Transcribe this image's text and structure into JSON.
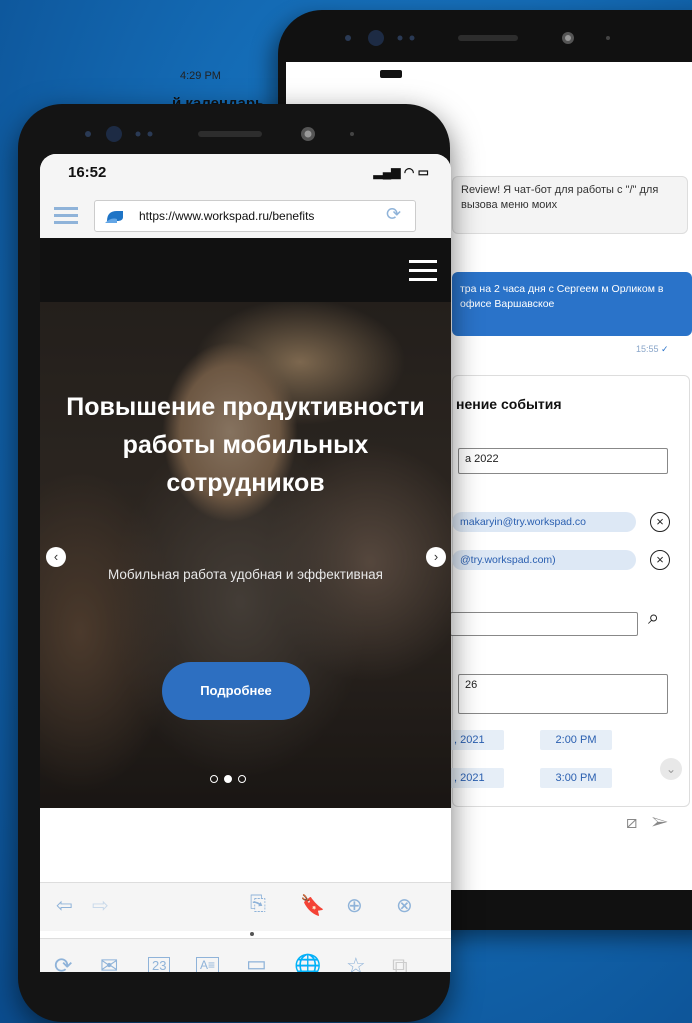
{
  "back_phone": {
    "status_time": "4:29 PM",
    "chat_title": "й календарь",
    "bot_message": "Review! Я чат-бот для работы с \"/\" для вызова меню моих",
    "user_message": "тра на 2 часа дня с Сергеем м Орликом в офисе Варшавское",
    "message_time": "15:55",
    "form_title": "нение события",
    "date_field": "а 2022",
    "participant_1": "makaryin@try.workspad.co",
    "participant_2": "@try.workspad.com)",
    "search_field": "",
    "room_field": "26",
    "start_date": ", 2021",
    "start_time": "2:00 PM",
    "end_date": ", 2021",
    "end_time": "3:00 PM"
  },
  "front_phone": {
    "status_time": "16:52",
    "status_icons": "…ıl ᯤ ▭",
    "url": "https://www.workspad.ru/benefits",
    "hero": {
      "title": "Повышение продуктивности работы мобильных сотрудников",
      "subtitle": "Мобильная работа удобная и эффективная",
      "button_label": "Подробнее",
      "prev_arrow": "‹",
      "next_arrow": "›",
      "slides_total": 3,
      "active_slide": 2
    },
    "toolbar": {
      "back": "⇦",
      "forward": "⇨",
      "share": "⎘",
      "bookmark": "🔖",
      "add": "⊕",
      "close": "⊗"
    },
    "dock": {
      "refresh": "⟳",
      "mail": "✉",
      "calendar": "23",
      "contacts": "A≡",
      "folder": "▭",
      "browser": "🌐",
      "favorites": "☆",
      "windows": "⧉"
    }
  }
}
